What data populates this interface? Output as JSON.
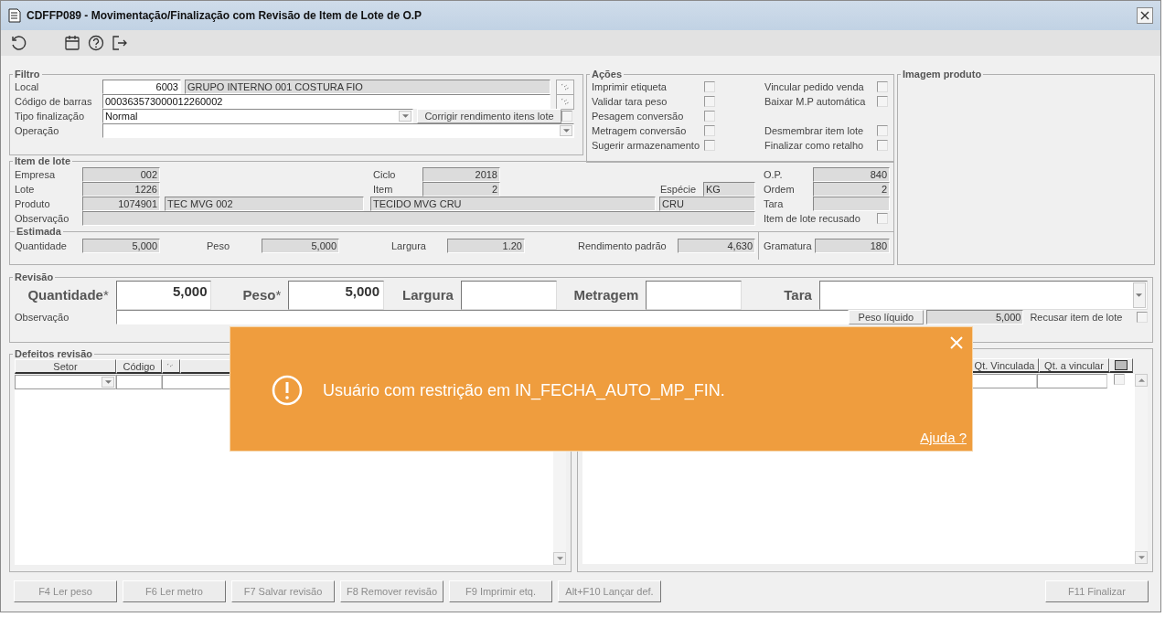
{
  "window": {
    "title": "CDFFP089 - Movimentação/Finalização com Revisão de Item de Lote de O.P"
  },
  "filtro": {
    "title": "Filtro",
    "local": {
      "label": "Local",
      "code": "6003",
      "name": "GRUPO INTERNO 001 COSTURA FIO"
    },
    "codigo_barras": {
      "label": "Código de barras",
      "value": "000363573000012260002"
    },
    "tipo": {
      "label": "Tipo finalização",
      "value": "Normal"
    },
    "corrigir": {
      "label": "Corrigir rendimento itens lote",
      "checked": false
    },
    "operacao": {
      "label": "Operação"
    }
  },
  "acoes": {
    "title": "Ações",
    "left": [
      {
        "label": "Imprimir etiqueta",
        "checked": false
      },
      {
        "label": "Validar tara peso",
        "checked": false
      },
      {
        "label": "Pesagem conversão",
        "checked": false
      },
      {
        "label": "Metragem conversão",
        "checked": false
      },
      {
        "label": "Sugerir armazenamento",
        "checked": false
      }
    ],
    "right": [
      {
        "label": "Vincular pedido venda",
        "checked": false
      },
      {
        "label": "Baixar M.P automática",
        "checked": false
      },
      {
        "label": "Desmembrar item lote",
        "checked": false
      },
      {
        "label": "Finalizar como retalho",
        "checked": false
      }
    ]
  },
  "imagem": {
    "title": "Imagem produto"
  },
  "item_lote": {
    "title": "Item de lote",
    "empresa": {
      "label": "Empresa",
      "value": "002"
    },
    "lote": {
      "label": "Lote",
      "value": "1226"
    },
    "produto": {
      "label": "Produto",
      "code": "1074901",
      "name": "TEC MVG 002",
      "description": "TECIDO MVG CRU",
      "variant": "CRU"
    },
    "observacao": {
      "label": "Observação"
    },
    "ciclo": {
      "label": "Ciclo",
      "value": "2018"
    },
    "item": {
      "label": "Item",
      "value": "2"
    },
    "especie": {
      "label": "Espécie",
      "value": "KG"
    },
    "op": {
      "label": "O.P.",
      "value": "840"
    },
    "ordem": {
      "label": "Ordem",
      "value": "2"
    },
    "tara": {
      "label": "Tara"
    },
    "recusado": {
      "label": "Item de lote recusado",
      "checked": false
    }
  },
  "estimada": {
    "title": "Estimada",
    "fields": [
      {
        "label": "Quantidade",
        "value": "5,000"
      },
      {
        "label": "Peso",
        "value": "5,000"
      },
      {
        "label": "Largura",
        "value": "1.20"
      },
      {
        "label": "Rendimento padrão",
        "value": "4,630"
      },
      {
        "label": "Gramatura",
        "value": "180"
      }
    ]
  },
  "revisao": {
    "title": "Revisão",
    "fields": [
      {
        "label": "Quantidade",
        "required_mark": "*",
        "value": "5,000"
      },
      {
        "label": "Peso",
        "required_mark": "*",
        "value": "5,000"
      },
      {
        "label": "Largura"
      },
      {
        "label": "Metragem"
      }
    ],
    "tara": {
      "label": "Tara"
    },
    "observacao": {
      "label": "Observação"
    },
    "peso_liquido": {
      "label": "Peso líquido",
      "value": "5,000"
    },
    "recusar": {
      "label": "Recusar item de lote",
      "checked": false
    }
  },
  "defeitos": {
    "title": "Defeitos revisão",
    "columns": [
      "Setor",
      "Código"
    ]
  },
  "vinculos": {
    "columns": [
      "Qt. Vinculada",
      "Qt. a vincular"
    ],
    "row_checked": false
  },
  "buttons": [
    {
      "label": "F4 Ler peso",
      "disabled": true
    },
    {
      "label": "F6 Ler metro",
      "disabled": true
    },
    {
      "label": "F7 Salvar revisão",
      "disabled": true
    },
    {
      "label": "F8 Remover revisão",
      "disabled": true
    },
    {
      "label": "F9 Imprimir etq.",
      "disabled": true
    },
    {
      "label": "Alt+F10 Lançar def.",
      "disabled": true
    }
  ],
  "finalizar": {
    "label": "F11 Finalizar",
    "disabled": true
  },
  "toast": {
    "message": "Usuário com restrição em IN_FECHA_AUTO_MP_FIN.",
    "link": "Ajuda ?"
  }
}
